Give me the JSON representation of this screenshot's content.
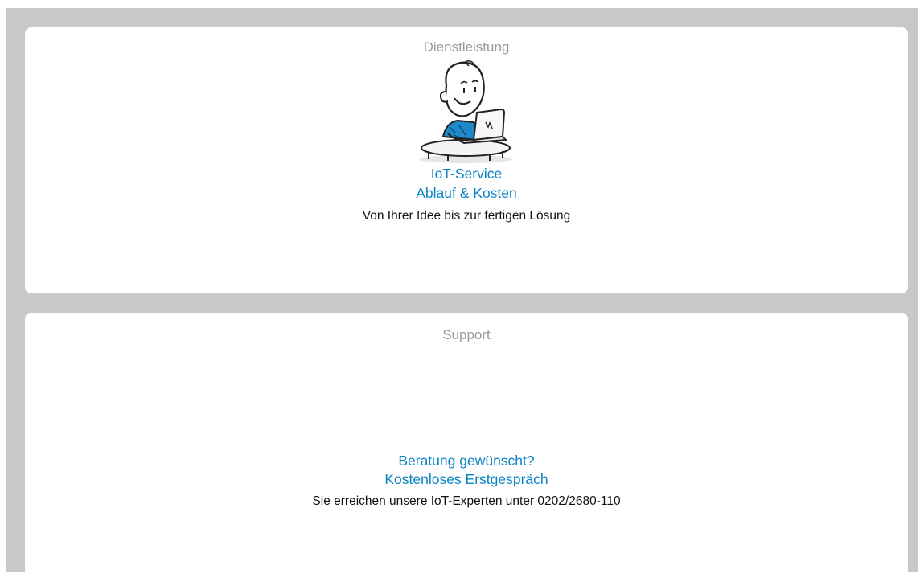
{
  "service": {
    "label": "Dienstleistung",
    "illustration": "person-at-laptop-illustration",
    "link_line_1": "IoT-Service",
    "link_line_2": "Ablauf & Kosten",
    "subtitle": "Von Ihrer Idee bis zur fertigen Lösung"
  },
  "support": {
    "label": "Support",
    "link_line_1": "Beratung gewünscht?",
    "link_line_2": "Kostenloses Erstgespräch",
    "subtitle": "Sie erreichen unsere IoT-Experten unter 0202/2680-110"
  },
  "colors": {
    "background": "#c8c8c8",
    "card": "#ffffff",
    "label": "#9a9a9a",
    "link": "#0b84c6",
    "text": "#111111",
    "accent": "#1e88c8"
  }
}
